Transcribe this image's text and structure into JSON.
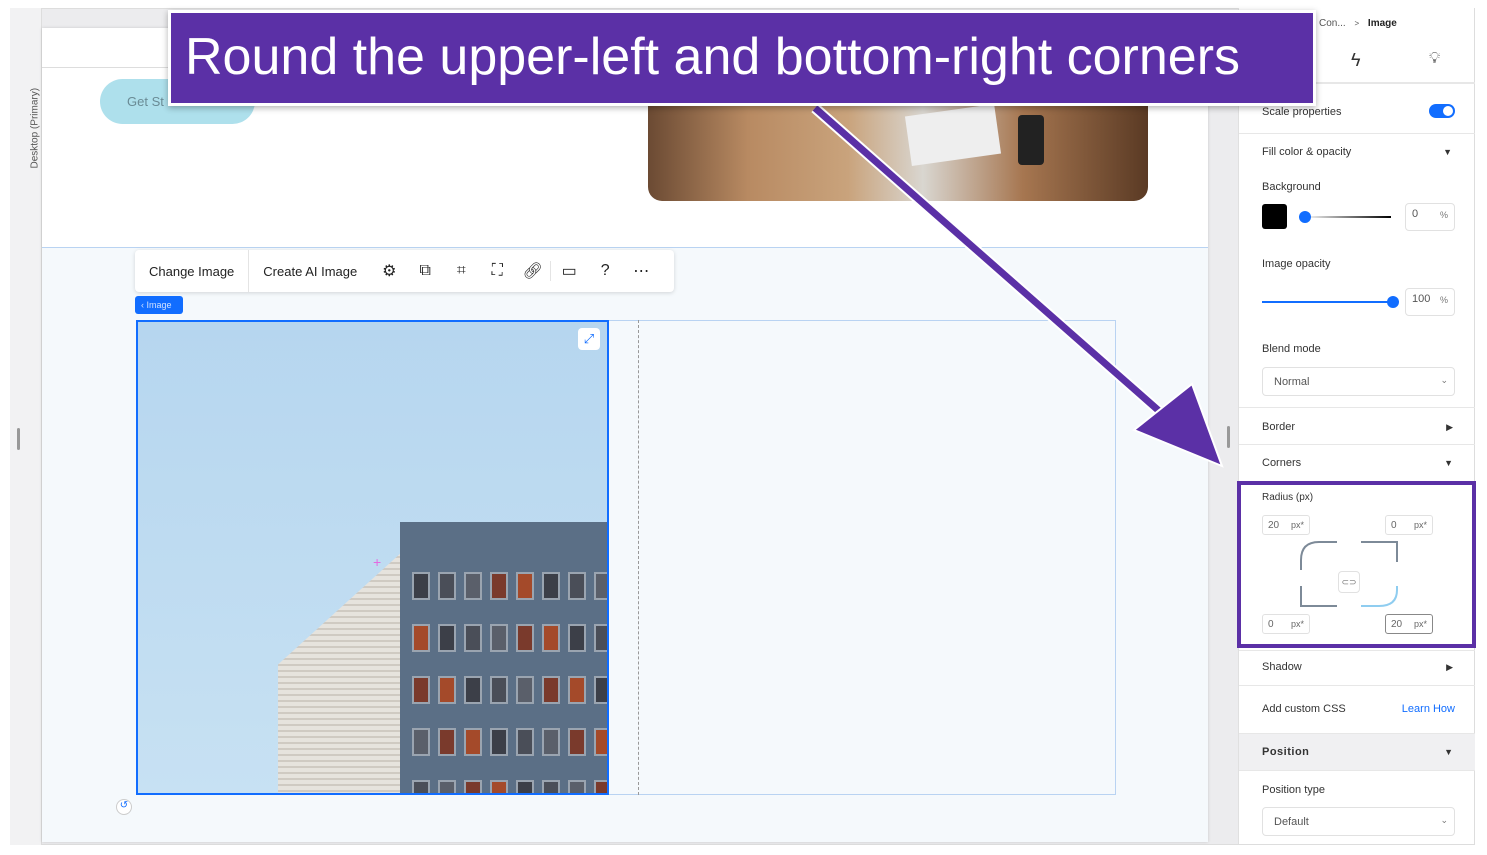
{
  "annotation": {
    "text": "Round the upper-left and bottom-right corners",
    "color": "#5b30a6"
  },
  "canvas": {
    "view_label": "Desktop (Primary)",
    "button_text": "Get St",
    "image_tag": "Image"
  },
  "toolbar": {
    "change_image": "Change Image",
    "create_ai_image": "Create AI Image",
    "icons": [
      "gear-icon",
      "layers-icon",
      "crop-icon",
      "focus-icon",
      "link-icon",
      "comment-icon",
      "help-icon",
      "more-icon"
    ]
  },
  "panel": {
    "breadcrumb": {
      "parent": "Con...",
      "sep": ">",
      "current": "Image"
    },
    "scale_properties": {
      "label": "Scale properties",
      "on": true
    },
    "fill": {
      "label": "Fill color & opacity",
      "background_label": "Background",
      "background_color": "#000000",
      "background_opacity": "0",
      "unit": "%",
      "image_opacity_label": "Image opacity",
      "image_opacity": "100"
    },
    "blend": {
      "label": "Blend mode",
      "value": "Normal"
    },
    "border": {
      "label": "Border"
    },
    "corners": {
      "label": "Corners",
      "radius_label": "Radius (px)",
      "top_left": "20",
      "top_right": "0",
      "bottom_left": "0",
      "bottom_right": "20",
      "unit": "px*"
    },
    "shadow": {
      "label": "Shadow"
    },
    "css": {
      "label": "Add custom CSS",
      "link": "Learn How"
    },
    "position": {
      "label": "Position",
      "type_label": "Position type",
      "type_value": "Default"
    },
    "accent": "#116dff"
  }
}
